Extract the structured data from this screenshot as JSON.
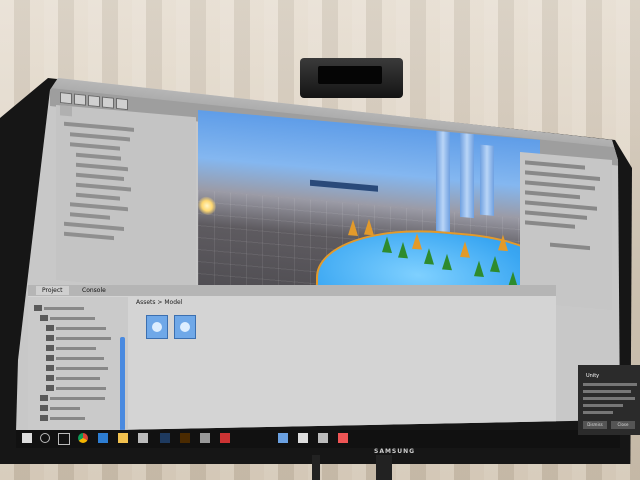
{
  "monitor": {
    "brand": "SAMSUNG"
  },
  "editor": {
    "panels": {
      "project_tab": "Project",
      "console_tab": "Console",
      "breadcrumb": "Assets > Model"
    },
    "notification": {
      "title": "Unity",
      "dismiss_label": "Dismiss",
      "close_label": "Close"
    }
  },
  "colors": {
    "sky": "#5f9de8",
    "water": "#39a6f2",
    "tree_green": "#2e8b2e",
    "tree_orange": "#e39a2a",
    "selection_blue": "#4a8ae0"
  },
  "taskbar": {
    "icons": [
      "windows-icon",
      "search-icon",
      "task-view-icon",
      "chrome-icon",
      "edge-icon",
      "file-explorer-icon",
      "store-icon",
      "photoshop-icon",
      "illustrator-icon",
      "mail-icon",
      "unity-icon"
    ]
  }
}
